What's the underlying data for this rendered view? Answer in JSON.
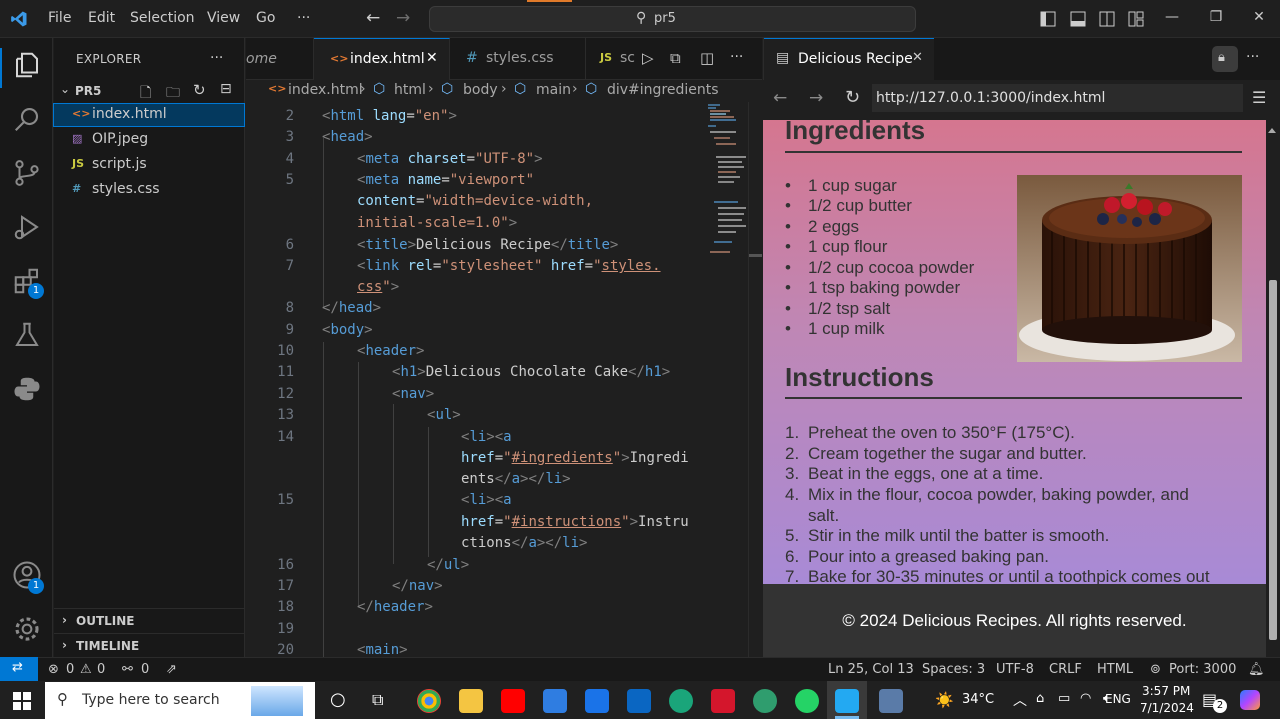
{
  "titlebar": {
    "menu": [
      "File",
      "Edit",
      "Selection",
      "View",
      "Go",
      "···"
    ],
    "command_center": "pr5"
  },
  "activity": {
    "extensions_badge": "1",
    "accounts_badge": "1"
  },
  "explorer": {
    "title": "EXPLORER",
    "more": "···",
    "folder": "PR5",
    "files": [
      {
        "icon": "<>",
        "name": "index.html"
      },
      {
        "icon": "▨",
        "name": "OIP.jpeg"
      },
      {
        "icon": "JS",
        "name": "script.js"
      },
      {
        "icon": "#",
        "name": "styles.css"
      }
    ],
    "outline": "OUTLINE",
    "timeline": "TIMELINE"
  },
  "editor": {
    "tabs": [
      "ome",
      "index.html",
      "styles.css",
      "sc"
    ],
    "more": "···",
    "breadcrumb": [
      "index.html",
      "html",
      "body",
      "main",
      "div#ingredients"
    ]
  },
  "preview": {
    "tab_title": "Delicious Recipe",
    "more": "···",
    "url": "http://127.0.0.1:3000/index.html",
    "ingredients_heading": "Ingredients",
    "ingredients": [
      "1 cup sugar",
      "1/2 cup butter",
      "2 eggs",
      "1 cup flour",
      "1/2 cup cocoa powder",
      "1 tsp baking powder",
      "1/2 tsp salt",
      "1 cup milk"
    ],
    "instructions_heading": "Instructions",
    "steps": [
      {
        "num": "1.",
        "text": "Preheat the oven to 350°F (175°C)."
      },
      {
        "num": "2.",
        "text": "Cream together the sugar and butter."
      },
      {
        "num": "3.",
        "text": "Beat in the eggs, one at a time."
      },
      {
        "num": "4.",
        "text": "Mix in the flour, cocoa powder, baking powder, and"
      },
      {
        "num": "",
        "text": "salt."
      },
      {
        "num": "5.",
        "text": "Stir in the milk until the batter is smooth."
      },
      {
        "num": "6.",
        "text": "Pour into a greased baking pan."
      },
      {
        "num": "7.",
        "text": "Bake for 30-35 minutes or until a toothpick comes out"
      }
    ],
    "footer": "© 2024 Delicious Recipes. All rights reserved."
  },
  "statusbar": {
    "errors": "0",
    "warnings": "0",
    "ports": "0",
    "position": "Ln 25, Col 13",
    "spaces": "Spaces: 3",
    "encoding": "UTF-8",
    "eol": "CRLF",
    "language": "HTML",
    "port": "Port: 3000"
  },
  "taskbar": {
    "search_placeholder": "Type here to search",
    "weather": "34°C",
    "lang": "ENG",
    "time": "3:57 PM",
    "date": "7/1/2024",
    "notif_count": "2"
  },
  "code": [
    {
      "n": "2",
      "html": "<span class='tg'>&lt;</span><span class='tn'>html</span> <span class='at'>lang</span><span class='tx'>=</span><span class='st'>\"en\"</span><span class='tg'>&gt;</span>"
    }
  ]
}
